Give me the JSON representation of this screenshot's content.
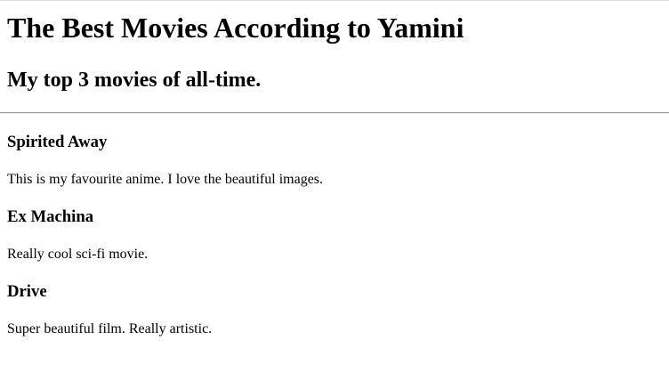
{
  "title": "The Best Movies According to Yamini",
  "subtitle": "My top 3 movies of all-time.",
  "movies": [
    {
      "name": "Spirited Away",
      "desc": "This is my favourite anime. I love the beautiful images."
    },
    {
      "name": "Ex Machina",
      "desc": "Really cool sci-fi movie."
    },
    {
      "name": "Drive",
      "desc": "Super beautiful film. Really artistic."
    }
  ]
}
